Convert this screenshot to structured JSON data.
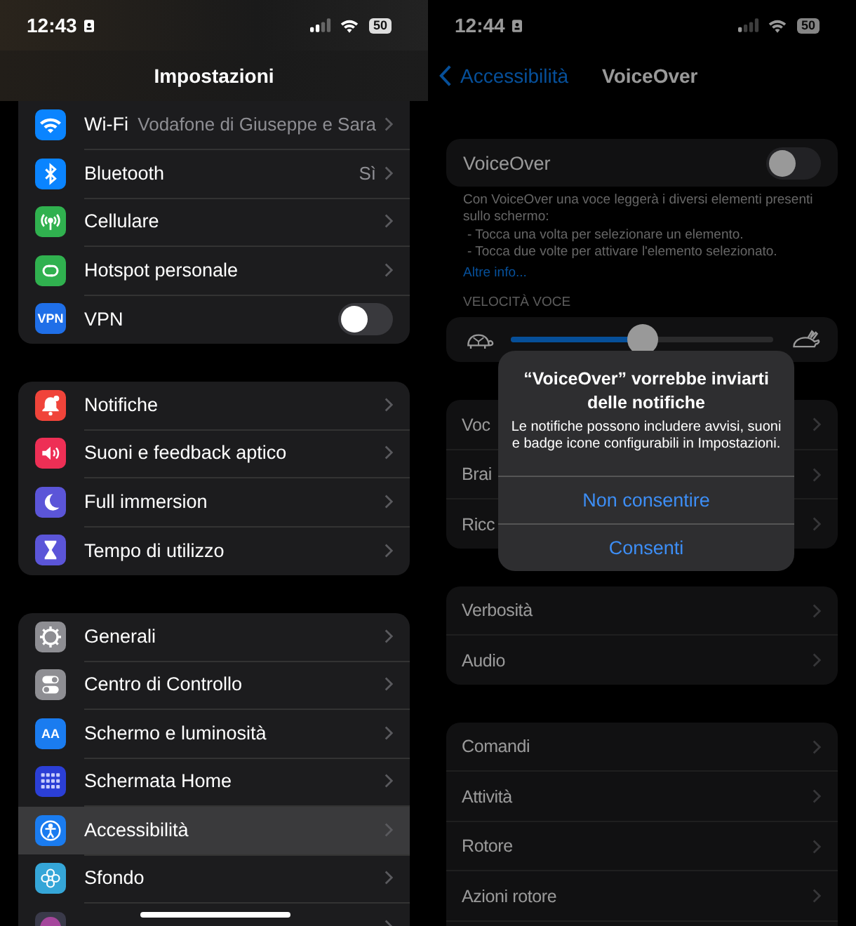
{
  "left": {
    "status": {
      "time": "12:43",
      "battery": "50"
    },
    "title": "Impostazioni",
    "groups": [
      {
        "rows": [
          {
            "label": "Wi-Fi",
            "value": "Vodafone di Giuseppe e Sara",
            "kind": "link",
            "color": "#0a84ff",
            "selected": false
          },
          {
            "label": "Bluetooth",
            "value": "Sì",
            "kind": "link",
            "color": "#0a84ff",
            "selected": false
          },
          {
            "label": "Cellulare",
            "kind": "link",
            "color": "#30b14f",
            "selected": false
          },
          {
            "label": "Hotspot personale",
            "kind": "link",
            "color": "#30b14f",
            "selected": false
          },
          {
            "label": "VPN",
            "kind": "toggle",
            "on": false,
            "color": "#1f6fe8",
            "icon_text": "VPN",
            "selected": false
          }
        ]
      },
      {
        "rows": [
          {
            "label": "Notifiche",
            "kind": "link",
            "color": "#f0443a",
            "selected": false
          },
          {
            "label": "Suoni e feedback aptico",
            "kind": "link",
            "color": "#ee2f55",
            "selected": false
          },
          {
            "label": "Full immersion",
            "kind": "link",
            "color": "#5b55d8",
            "selected": false
          },
          {
            "label": "Tempo di utilizzo",
            "kind": "link",
            "color": "#5b55d8",
            "selected": false
          }
        ]
      },
      {
        "rows": [
          {
            "label": "Generali",
            "kind": "link",
            "color": "#8e8e93",
            "selected": false
          },
          {
            "label": "Centro di Controllo",
            "kind": "link",
            "color": "#8e8e93",
            "selected": false
          },
          {
            "label": "Schermo e luminosità",
            "kind": "link",
            "color": "#1a7cf0",
            "icon_text": "AA",
            "selected": false
          },
          {
            "label": "Schermata Home",
            "kind": "link",
            "color": "#2b3fd6",
            "selected": false
          },
          {
            "label": "Accessibilità",
            "kind": "link",
            "color": "#1a7cf0",
            "selected": true
          },
          {
            "label": "Sfondo",
            "kind": "link",
            "color": "#35a6d8",
            "selected": false
          },
          {
            "kind": "link",
            "color": "#3a3a4a",
            "selected": false
          }
        ]
      }
    ]
  },
  "right": {
    "status": {
      "time": "12:44",
      "battery": "50"
    },
    "back_label": "Accessibilità",
    "title": "VoiceOver",
    "voiceover": {
      "label": "VoiceOver",
      "on": false
    },
    "footer": [
      "Con VoiceOver una voce leggerà i diversi elementi presenti sullo schermo:",
      "- Tocca una volta per selezionare un elemento.",
      "- Tocca due volte per attivare l'elemento selezionato."
    ],
    "more_link": "Altre info...",
    "speed_header": "VELOCITÀ VOCE",
    "speed": {
      "level": 0.5
    },
    "groups": [
      {
        "rows": [
          "Voc",
          "Brai",
          "Ricc"
        ]
      },
      {
        "rows": [
          "Verbosità",
          "Audio"
        ]
      },
      {
        "rows": [
          "Comandi",
          "Attività",
          "Rotore",
          "Azioni rotore"
        ]
      }
    ],
    "dialog": {
      "title": "“VoiceOver” vorrebbe inviarti delle notifiche",
      "message": "Le notifiche possono includere avvisi, suoni e badge icone configurabili in Impostazioni.",
      "buttons": [
        "Non consentire",
        "Consenti"
      ]
    }
  }
}
